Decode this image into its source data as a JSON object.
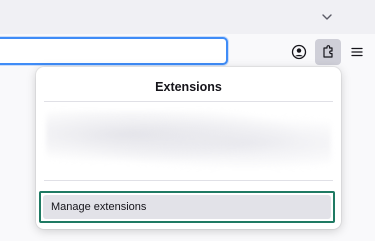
{
  "toolbar": {
    "list_tabs_icon": "chevron-down-icon",
    "account_icon": "account-icon",
    "extensions_icon": "puzzle-piece-icon",
    "menu_icon": "hamburger-menu-icon"
  },
  "extensions_panel": {
    "title": "Extensions",
    "manage_label": "Manage extensions",
    "highlight_color": "#1f7a63"
  },
  "colors": {
    "accent_focus": "#3f8cf7",
    "active_button_bg": "#cfcfd8"
  }
}
